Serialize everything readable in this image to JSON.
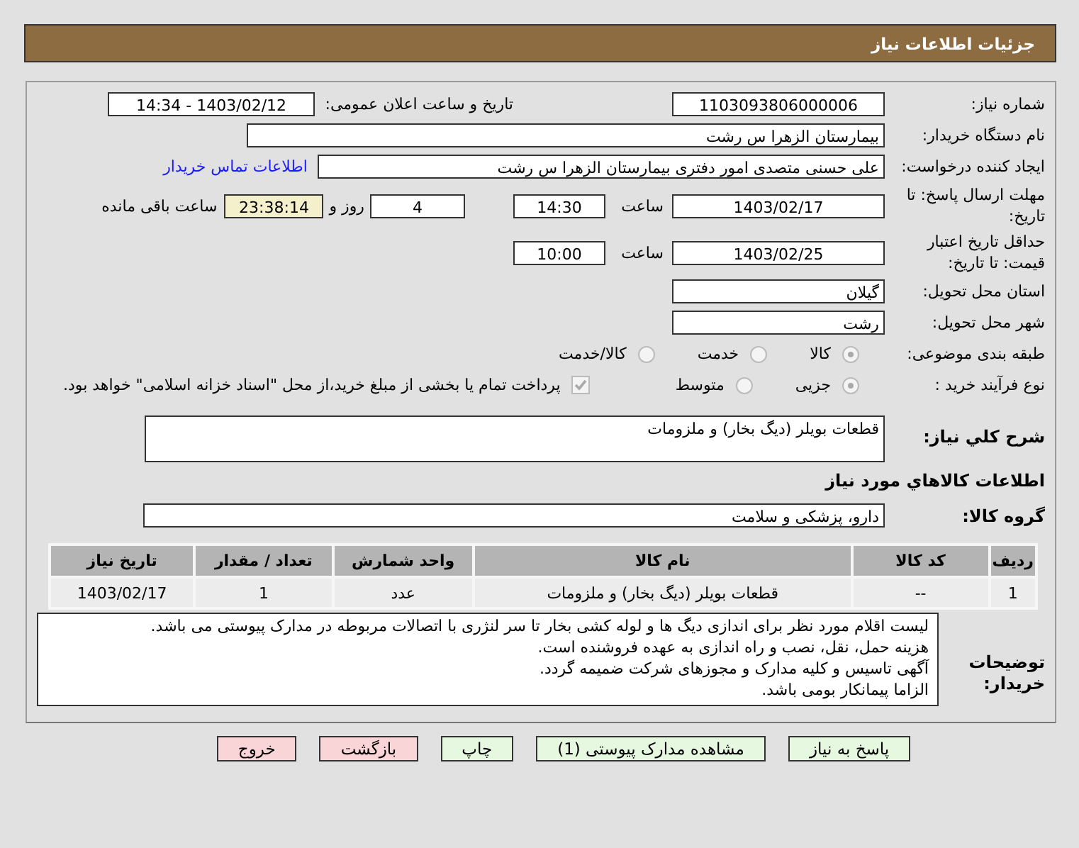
{
  "header": {
    "title": "جزئیات اطلاعات نیاز"
  },
  "need_number": {
    "label": "شماره نیاز:",
    "value": "1103093806000006"
  },
  "announce_date": {
    "label": "تاریخ و ساعت اعلان عمومی:",
    "value": "1403/02/12 - 14:34"
  },
  "buyer_org": {
    "label": "نام دستگاه خریدار:",
    "value": "بیمارستان الزهرا  س  رشت"
  },
  "requester": {
    "label": "ایجاد کننده درخواست:",
    "value": "علی حسنی متصدی امور دفتری بیمارستان الزهرا  س  رشت",
    "link": "اطلاعات تماس خریدار"
  },
  "reply_deadline": {
    "label": "مهلت ارسال پاسخ: تا تاریخ:",
    "date": "1403/02/17",
    "time_label": "ساعت",
    "time": "14:30",
    "days": "4",
    "days_label": "روز و",
    "remaining": "23:38:14",
    "remaining_label": "ساعت باقی مانده"
  },
  "price_validity": {
    "label": "حداقل تاریخ اعتبار قیمت: تا تاریخ:",
    "date": "1403/02/25",
    "time_label": "ساعت",
    "time": "10:00"
  },
  "province": {
    "label": "استان محل تحویل:",
    "value": "گیلان"
  },
  "city": {
    "label": "شهر محل تحویل:",
    "value": "رشت"
  },
  "classification": {
    "label": "طبقه بندی موضوعی:",
    "options": [
      {
        "label": "کالا",
        "selected": true
      },
      {
        "label": "خدمت",
        "selected": false
      },
      {
        "label": "کالا/خدمت",
        "selected": false
      }
    ]
  },
  "purchase_process": {
    "label": "نوع فرآیند خرید :",
    "options": [
      {
        "label": "جزیی",
        "selected": true
      },
      {
        "label": "متوسط",
        "selected": false
      }
    ],
    "payment": {
      "label": "پرداخت تمام یا بخشی از مبلغ خرید،از محل \"اسناد خزانه اسلامی\" خواهد بود.",
      "checked": true
    }
  },
  "summary": {
    "label": "شرح کلي نیاز:",
    "value": "قطعات بویلر (دیگ بخار) و ملزومات"
  },
  "goods_heading": "اطلاعات کالاهاي مورد نیاز",
  "goods_group": {
    "label": "گروه کالا:",
    "value": "دارو، پزشکی و سلامت"
  },
  "table": {
    "columns": [
      "ردیف",
      "کد کالا",
      "نام کالا",
      "واحد شمارش",
      "تعداد / مقدار",
      "تاریخ نیاز"
    ],
    "rows": [
      [
        "1",
        "--",
        "قطعات بویلر (دیگ بخار) و ملزومات",
        "عدد",
        "1",
        "1403/02/17"
      ]
    ]
  },
  "buyer_notes": {
    "label": "توضیحات خریدار:",
    "value": "لیست اقلام مورد نظر برای اندازی دیگ ها و لوله کشی بخار تا سر لنژری با اتصالات مربوطه در مدارک پیوستی می باشد.\nهزینه حمل، نقل، نصب و راه اندازی به عهده فروشنده است.\nآگهی تاسیس و کلیه مدارک و مجوزهای شرکت ضمیمه گردد.\nالزاما پیمانکار بومی باشد."
  },
  "buttons": [
    {
      "label": "پاسخ به نیاز",
      "kind": "action"
    },
    {
      "label": "مشاهده مدارک پیوستی (1)",
      "kind": "action"
    },
    {
      "label": "چاپ",
      "kind": "action"
    },
    {
      "label": "بازگشت",
      "kind": "exit"
    },
    {
      "label": "خروج",
      "kind": "exit"
    }
  ]
}
